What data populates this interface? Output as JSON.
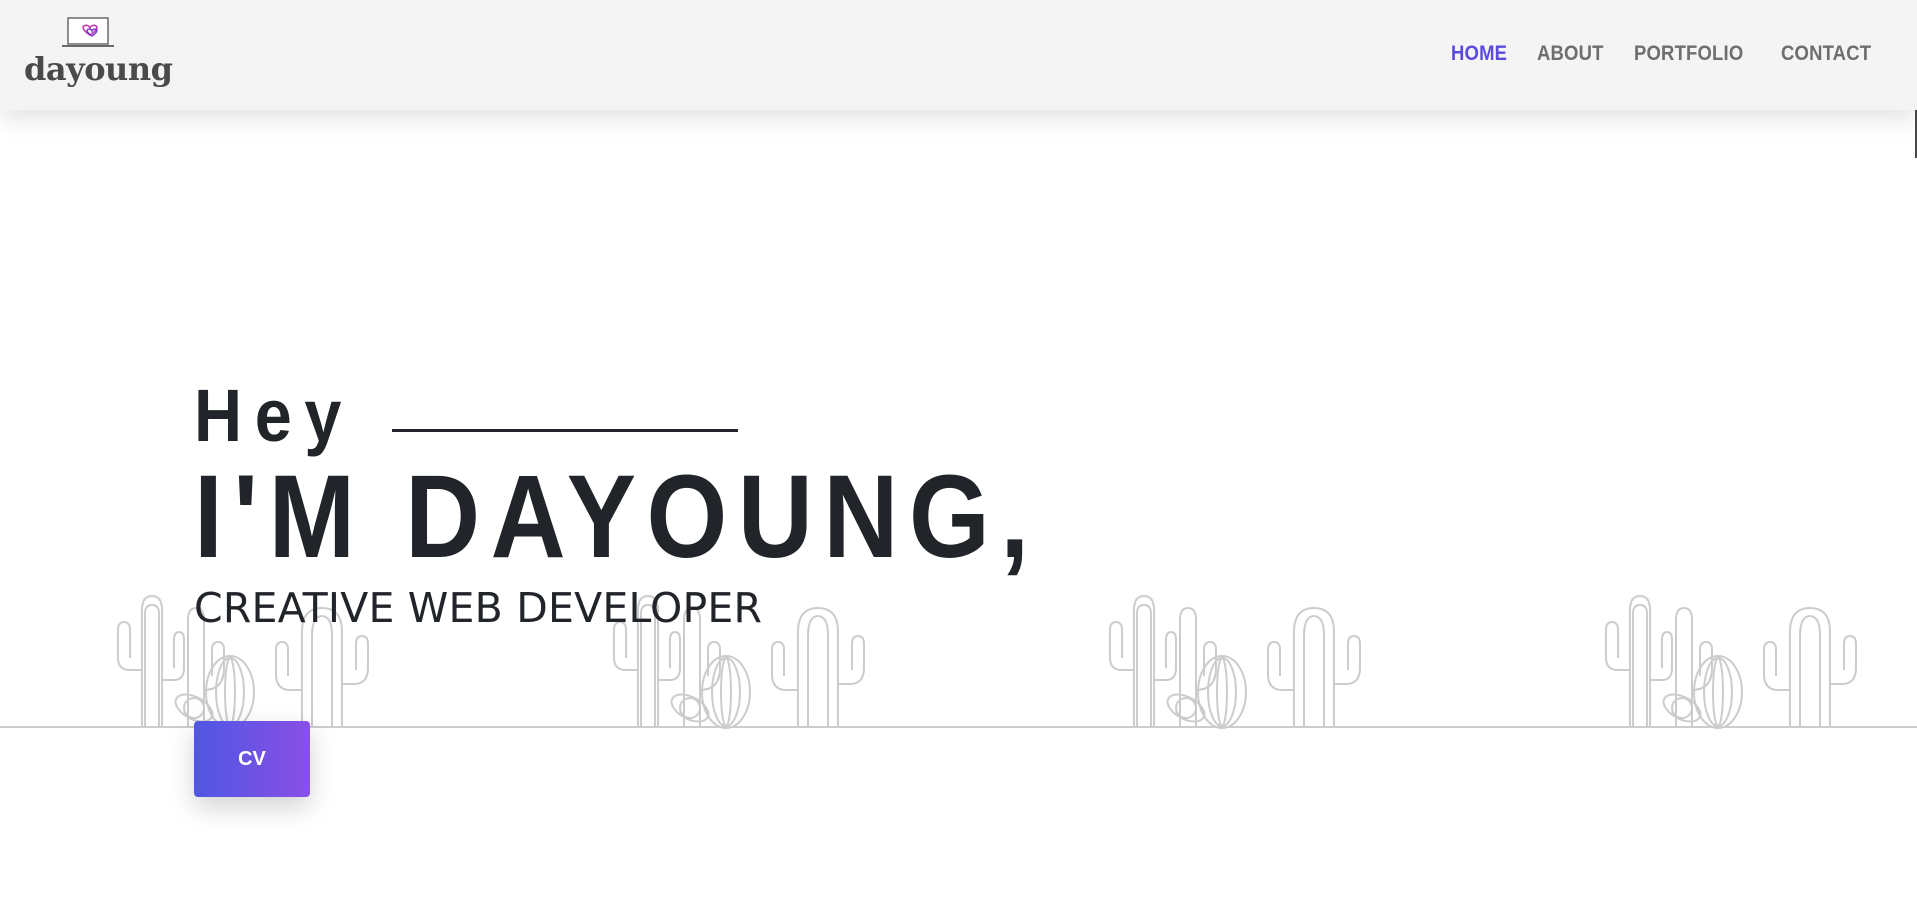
{
  "header": {
    "logo_text": "dayoung",
    "logo_icon": "laptop-heart-icon",
    "nav": [
      {
        "label": "HOME",
        "active": true
      },
      {
        "label": "ABOUT",
        "active": false
      },
      {
        "label": "PORTFOLIO",
        "active": false
      },
      {
        "label": "CONTACT",
        "active": false
      }
    ]
  },
  "hero": {
    "greeting": "Hey",
    "name": "I'M DAYOUNG,",
    "subtitle": "CREATIVE WEB DEVELOPER",
    "cv_label": "CV",
    "decoration": "cactus-line-art"
  },
  "colors": {
    "accent": "#5b4bdb",
    "button_start": "#4f57e3",
    "button_end": "#8a4fe6",
    "text": "#212428",
    "nav_text": "#6e6e6e",
    "header_bg": "#f4f4f4"
  }
}
